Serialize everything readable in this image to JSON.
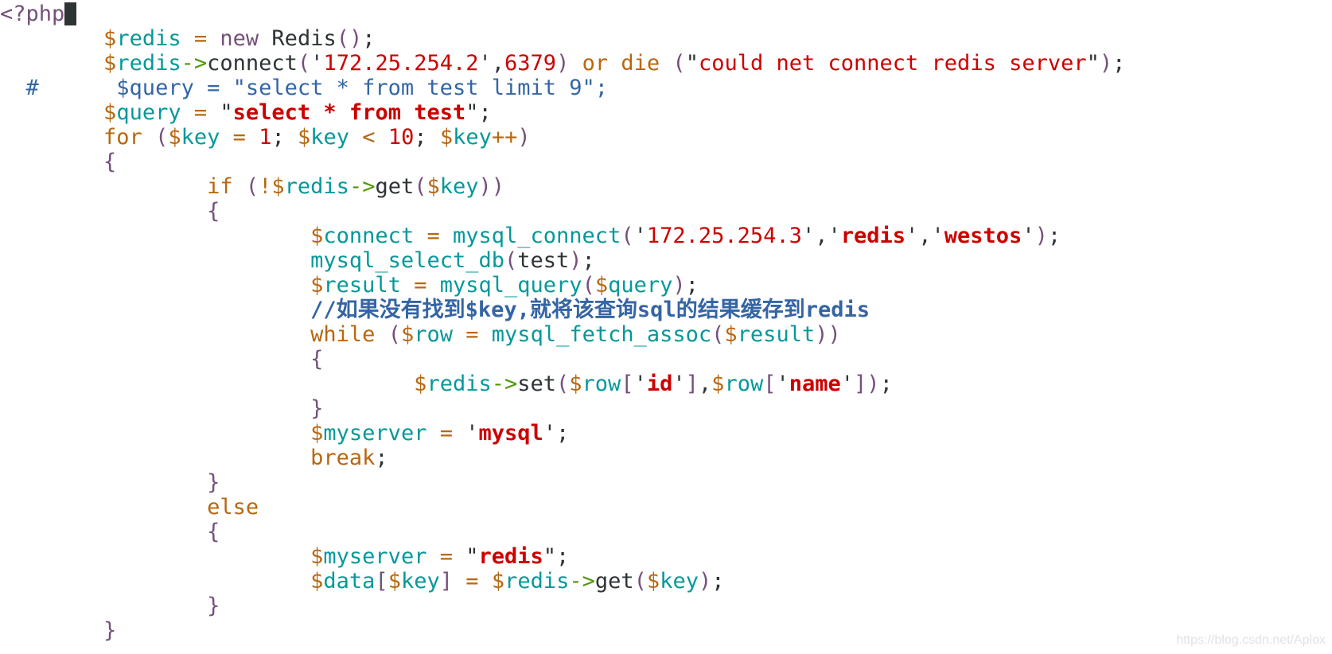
{
  "editor": {
    "colors": {
      "purple": "#75507b",
      "orange": "#b8670f",
      "teal": "#06989a",
      "red": "#cc0000",
      "blue": "#3465a4",
      "green": "#4e9a06",
      "text": "#2e3436"
    },
    "lines": [
      [
        [
          "p",
          "<?php"
        ]
      ],
      [
        [
          "k",
          "        "
        ],
        [
          "o",
          "$"
        ],
        [
          "t",
          "redis"
        ],
        [
          "k",
          " "
        ],
        [
          "o",
          "="
        ],
        [
          "k",
          " "
        ],
        [
          "p",
          "new"
        ],
        [
          "k",
          " Redis"
        ],
        [
          "p",
          "()"
        ],
        [
          "k",
          ";"
        ]
      ],
      [
        [
          "k",
          "        "
        ],
        [
          "o",
          "$"
        ],
        [
          "t",
          "redis"
        ],
        [
          "g",
          "->"
        ],
        [
          "k",
          "connect"
        ],
        [
          "p",
          "("
        ],
        [
          "k",
          "'"
        ],
        [
          "r",
          "172.25.254.2"
        ],
        [
          "k",
          "',"
        ],
        [
          "r",
          "6379"
        ],
        [
          "p",
          ")"
        ],
        [
          "k",
          " "
        ],
        [
          "o",
          "or"
        ],
        [
          "k",
          " "
        ],
        [
          "o",
          "die"
        ],
        [
          "k",
          " "
        ],
        [
          "p",
          "("
        ],
        [
          "k",
          "\""
        ],
        [
          "r",
          "could net connect redis server"
        ],
        [
          "k",
          "\""
        ],
        [
          "p",
          ")"
        ],
        [
          "k",
          ";"
        ]
      ],
      [
        [
          "b",
          "  #      $query = \"select * from test limit 9\";"
        ]
      ],
      [
        [
          "k",
          "        "
        ],
        [
          "o",
          "$"
        ],
        [
          "t",
          "query"
        ],
        [
          "k",
          " "
        ],
        [
          "o",
          "="
        ],
        [
          "k",
          " \""
        ],
        [
          "s",
          "select * from test"
        ],
        [
          "k",
          "\";"
        ]
      ],
      [
        [
          "k",
          "        "
        ],
        [
          "o",
          "for"
        ],
        [
          "k",
          " "
        ],
        [
          "p",
          "("
        ],
        [
          "o",
          "$"
        ],
        [
          "t",
          "key"
        ],
        [
          "k",
          " "
        ],
        [
          "o",
          "="
        ],
        [
          "k",
          " "
        ],
        [
          "r",
          "1"
        ],
        [
          "k",
          "; "
        ],
        [
          "o",
          "$"
        ],
        [
          "t",
          "key"
        ],
        [
          "k",
          " "
        ],
        [
          "o",
          "<"
        ],
        [
          "k",
          " "
        ],
        [
          "r",
          "10"
        ],
        [
          "k",
          "; "
        ],
        [
          "o",
          "$"
        ],
        [
          "t",
          "key"
        ],
        [
          "o",
          "++"
        ],
        [
          "p",
          ")"
        ]
      ],
      [
        [
          "k",
          "        "
        ],
        [
          "p",
          "{"
        ]
      ],
      [
        [
          "k",
          "                "
        ],
        [
          "o",
          "if"
        ],
        [
          "k",
          " "
        ],
        [
          "p",
          "("
        ],
        [
          "o",
          "!$"
        ],
        [
          "t",
          "redis"
        ],
        [
          "g",
          "->"
        ],
        [
          "k",
          "get"
        ],
        [
          "p",
          "("
        ],
        [
          "o",
          "$"
        ],
        [
          "t",
          "key"
        ],
        [
          "p",
          "))"
        ]
      ],
      [
        [
          "k",
          "                "
        ],
        [
          "p",
          "{"
        ]
      ],
      [
        [
          "k",
          "                        "
        ],
        [
          "o",
          "$"
        ],
        [
          "t",
          "connect"
        ],
        [
          "k",
          " "
        ],
        [
          "o",
          "="
        ],
        [
          "k",
          " "
        ],
        [
          "t",
          "mysql_connect"
        ],
        [
          "p",
          "("
        ],
        [
          "k",
          "'"
        ],
        [
          "r",
          "172.25.254.3"
        ],
        [
          "k",
          "','"
        ],
        [
          "s",
          "redis"
        ],
        [
          "k",
          "','"
        ],
        [
          "s",
          "westos"
        ],
        [
          "k",
          "'"
        ],
        [
          "p",
          ")"
        ],
        [
          "k",
          ";"
        ]
      ],
      [
        [
          "k",
          "                        "
        ],
        [
          "t",
          "mysql_select_db"
        ],
        [
          "p",
          "("
        ],
        [
          "k",
          "test"
        ],
        [
          "p",
          ")"
        ],
        [
          "k",
          ";"
        ]
      ],
      [
        [
          "k",
          "                        "
        ],
        [
          "o",
          "$"
        ],
        [
          "t",
          "result"
        ],
        [
          "k",
          " "
        ],
        [
          "o",
          "="
        ],
        [
          "k",
          " "
        ],
        [
          "t",
          "mysql_query"
        ],
        [
          "p",
          "("
        ],
        [
          "o",
          "$"
        ],
        [
          "t",
          "query"
        ],
        [
          "p",
          ")"
        ],
        [
          "k",
          ";"
        ]
      ],
      [
        [
          "k",
          "                        "
        ],
        [
          "bb",
          "//如果没有找到$key,就将该查询sql的结果缓存到redis"
        ]
      ],
      [
        [
          "k",
          "                        "
        ],
        [
          "o",
          "while"
        ],
        [
          "k",
          " "
        ],
        [
          "p",
          "("
        ],
        [
          "o",
          "$"
        ],
        [
          "t",
          "row"
        ],
        [
          "k",
          " "
        ],
        [
          "o",
          "="
        ],
        [
          "k",
          " "
        ],
        [
          "t",
          "mysql_fetch_assoc"
        ],
        [
          "p",
          "("
        ],
        [
          "o",
          "$"
        ],
        [
          "t",
          "result"
        ],
        [
          "p",
          "))"
        ]
      ],
      [
        [
          "k",
          "                        "
        ],
        [
          "p",
          "{"
        ]
      ],
      [
        [
          "k",
          "                                "
        ],
        [
          "o",
          "$"
        ],
        [
          "t",
          "redis"
        ],
        [
          "g",
          "->"
        ],
        [
          "k",
          "set"
        ],
        [
          "p",
          "("
        ],
        [
          "o",
          "$"
        ],
        [
          "t",
          "row"
        ],
        [
          "p",
          "["
        ],
        [
          "k",
          "'"
        ],
        [
          "s",
          "id"
        ],
        [
          "k",
          "'"
        ],
        [
          "p",
          "]"
        ],
        [
          "k",
          ","
        ],
        [
          "o",
          "$"
        ],
        [
          "t",
          "row"
        ],
        [
          "p",
          "["
        ],
        [
          "k",
          "'"
        ],
        [
          "s",
          "name"
        ],
        [
          "k",
          "'"
        ],
        [
          "p",
          "])"
        ],
        [
          "k",
          ";"
        ]
      ],
      [
        [
          "k",
          "                        "
        ],
        [
          "p",
          "}"
        ]
      ],
      [
        [
          "k",
          "                        "
        ],
        [
          "o",
          "$"
        ],
        [
          "t",
          "myserver"
        ],
        [
          "k",
          " "
        ],
        [
          "o",
          "="
        ],
        [
          "k",
          " '"
        ],
        [
          "s",
          "mysql"
        ],
        [
          "k",
          "';"
        ]
      ],
      [
        [
          "k",
          "                        "
        ],
        [
          "o",
          "break"
        ],
        [
          "k",
          ";"
        ]
      ],
      [
        [
          "k",
          "                "
        ],
        [
          "p",
          "}"
        ]
      ],
      [
        [
          "k",
          "                "
        ],
        [
          "o",
          "else"
        ]
      ],
      [
        [
          "k",
          "                "
        ],
        [
          "p",
          "{"
        ]
      ],
      [
        [
          "k",
          "                        "
        ],
        [
          "o",
          "$"
        ],
        [
          "t",
          "myserver"
        ],
        [
          "k",
          " "
        ],
        [
          "o",
          "="
        ],
        [
          "k",
          " \""
        ],
        [
          "s",
          "redis"
        ],
        [
          "k",
          "\";"
        ]
      ],
      [
        [
          "k",
          "                        "
        ],
        [
          "o",
          "$"
        ],
        [
          "t",
          "data"
        ],
        [
          "p",
          "["
        ],
        [
          "o",
          "$"
        ],
        [
          "t",
          "key"
        ],
        [
          "p",
          "]"
        ],
        [
          "k",
          " "
        ],
        [
          "o",
          "="
        ],
        [
          "k",
          " "
        ],
        [
          "o",
          "$"
        ],
        [
          "t",
          "redis"
        ],
        [
          "g",
          "->"
        ],
        [
          "k",
          "get"
        ],
        [
          "p",
          "("
        ],
        [
          "o",
          "$"
        ],
        [
          "t",
          "key"
        ],
        [
          "p",
          ")"
        ],
        [
          "k",
          ";"
        ]
      ],
      [
        [
          "k",
          "                "
        ],
        [
          "p",
          "}"
        ]
      ],
      [
        [
          "k",
          "        "
        ],
        [
          "p",
          "}"
        ]
      ]
    ]
  },
  "watermark": "https://blog.csdn.net/Aplox"
}
